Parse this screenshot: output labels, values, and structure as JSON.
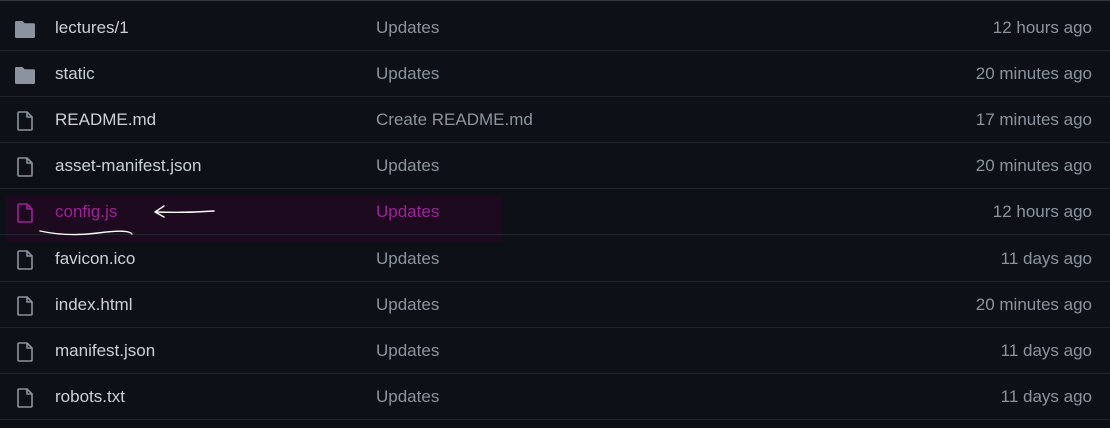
{
  "files": [
    {
      "name": "lectures/1",
      "message": "Updates",
      "age": "12 hours ago",
      "icon": "folder-icon",
      "highlighted": false
    },
    {
      "name": "static",
      "message": "Updates",
      "age": "20 minutes ago",
      "icon": "folder-icon",
      "highlighted": false
    },
    {
      "name": "README.md",
      "message": "Create README.md",
      "age": "17 minutes ago",
      "icon": "file-icon",
      "highlighted": false
    },
    {
      "name": "asset-manifest.json",
      "message": "Updates",
      "age": "20 minutes ago",
      "icon": "file-icon",
      "highlighted": false
    },
    {
      "name": "config.js",
      "message": "Updates",
      "age": "12 hours ago",
      "icon": "file-icon",
      "highlighted": true
    },
    {
      "name": "favicon.ico",
      "message": "Updates",
      "age": "11 days ago",
      "icon": "file-icon",
      "highlighted": false
    },
    {
      "name": "index.html",
      "message": "Updates",
      "age": "20 minutes ago",
      "icon": "file-icon",
      "highlighted": false
    },
    {
      "name": "manifest.json",
      "message": "Updates",
      "age": "11 days ago",
      "icon": "file-icon",
      "highlighted": false
    },
    {
      "name": "robots.txt",
      "message": "Updates",
      "age": "11 days ago",
      "icon": "file-icon",
      "highlighted": false
    }
  ],
  "colors": {
    "background": "#0d1117",
    "text": "#c9d1d9",
    "muted": "#8b949e",
    "highlight_text": "#a0209a",
    "highlight_bg": "#1d0a1f",
    "annotation": "#ffffff"
  }
}
